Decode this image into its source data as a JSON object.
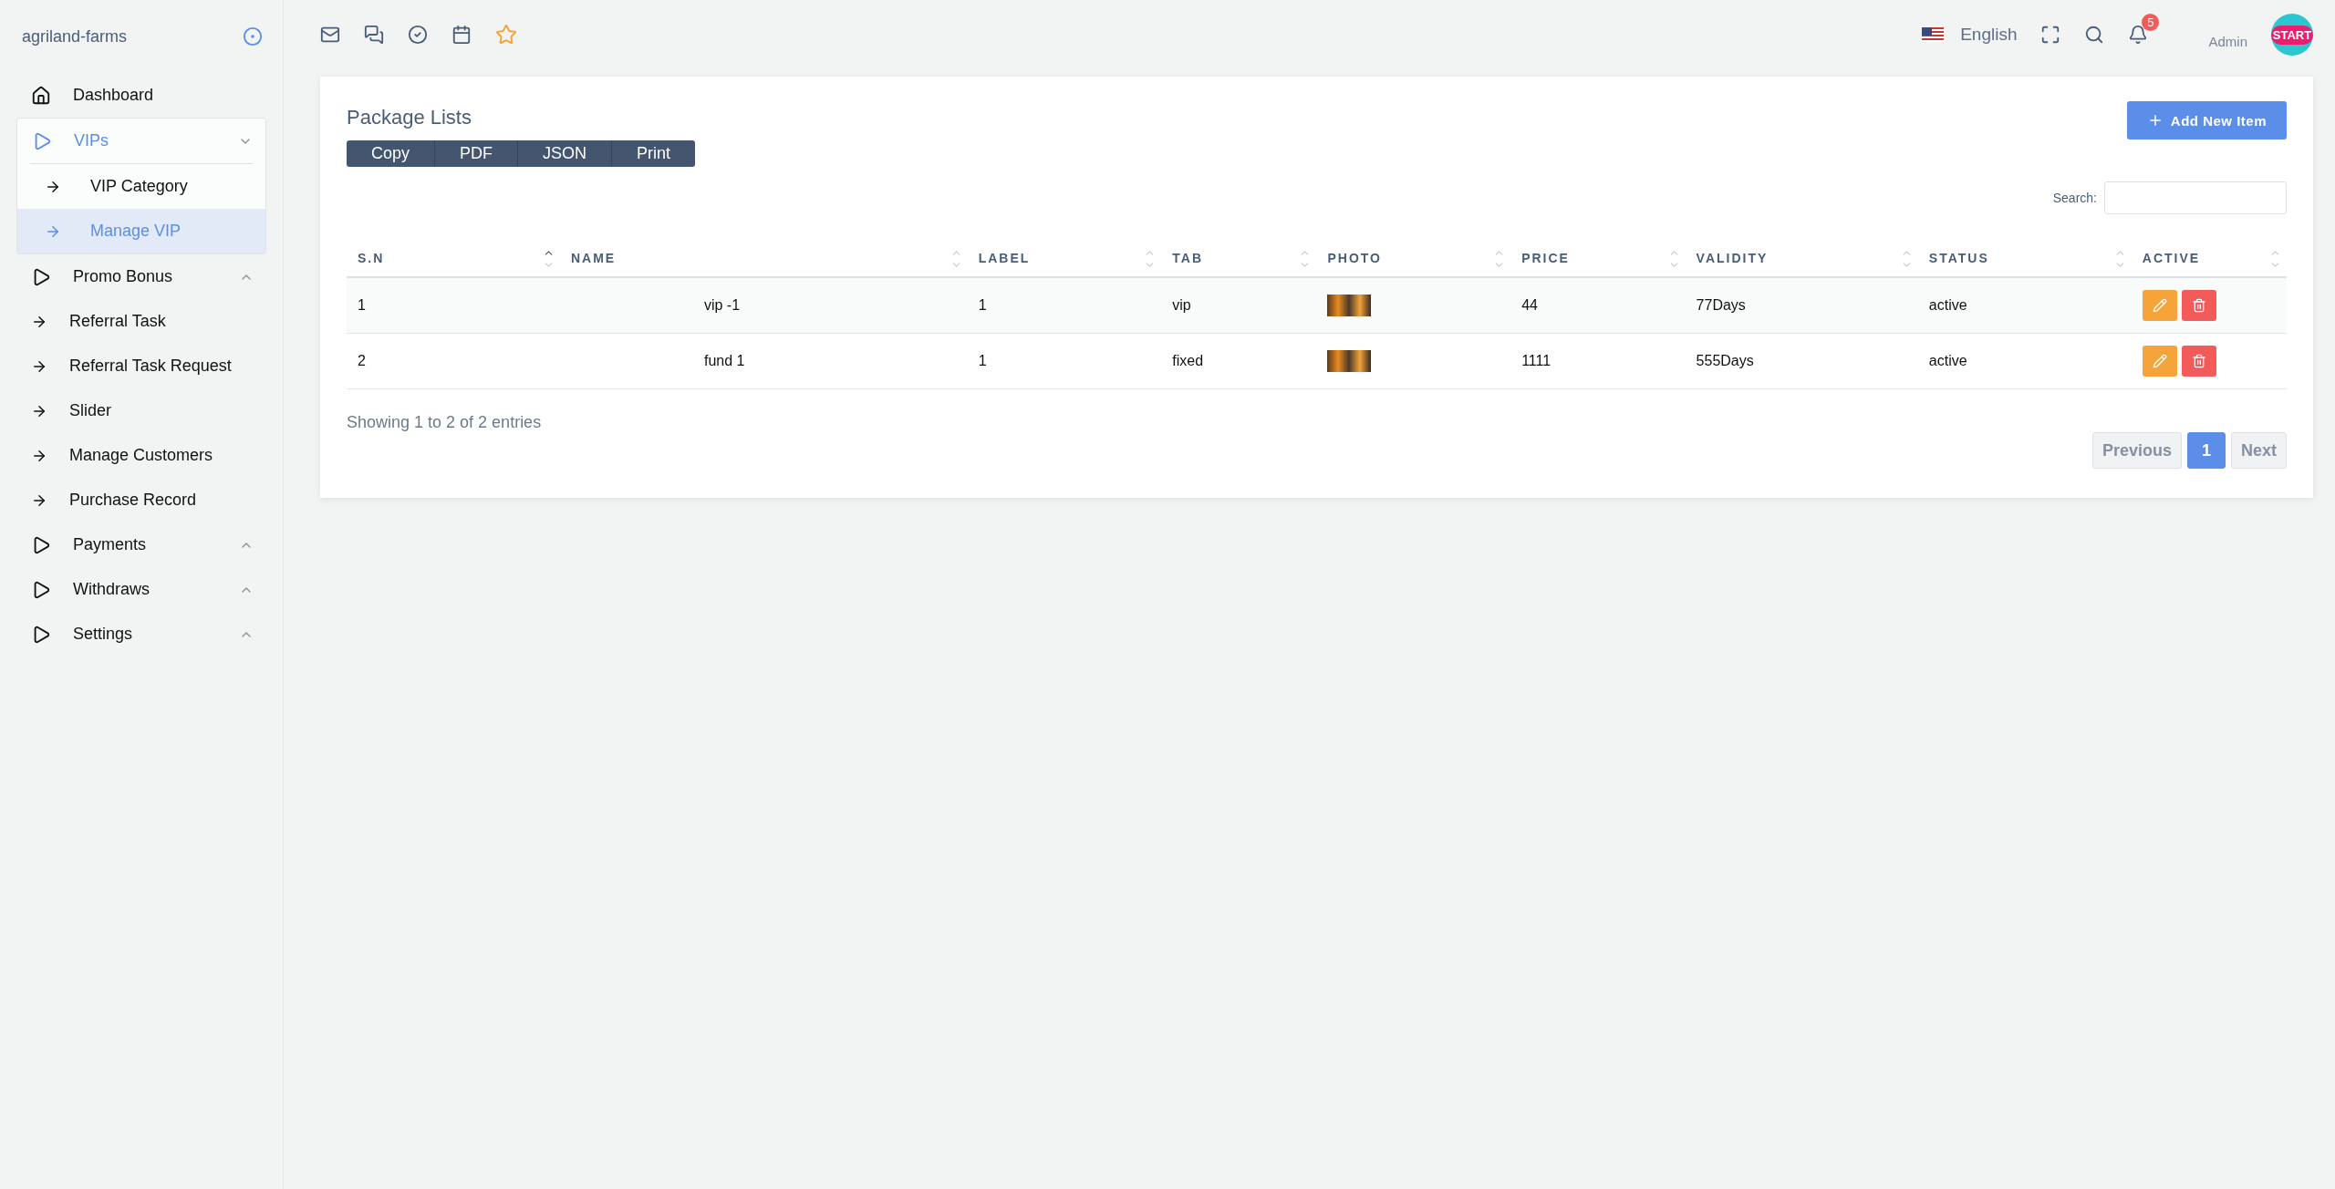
{
  "sidebar": {
    "brand": "agriland-farms",
    "items": [
      {
        "kind": "home",
        "label": "Dashboard",
        "selected": false
      },
      {
        "kind": "group",
        "label": "VIPs",
        "expanded": true,
        "children": [
          {
            "label": "VIP Category",
            "selected": false
          },
          {
            "label": "Manage VIP",
            "selected": true
          }
        ]
      },
      {
        "kind": "group",
        "label": "Promo Bonus",
        "expanded": false
      },
      {
        "kind": "link",
        "label": "Referral Task",
        "selected": false
      },
      {
        "kind": "link",
        "label": "Referral Task Request",
        "selected": false
      },
      {
        "kind": "link",
        "label": "Slider",
        "selected": false
      },
      {
        "kind": "link",
        "label": "Manage Customers",
        "selected": false
      },
      {
        "kind": "link",
        "label": "Purchase Record",
        "selected": false
      },
      {
        "kind": "group",
        "label": "Payments",
        "expanded": false
      },
      {
        "kind": "group",
        "label": "Withdraws",
        "expanded": false
      },
      {
        "kind": "group",
        "label": "Settings",
        "expanded": false
      }
    ]
  },
  "topbar": {
    "language": "English",
    "notifications": "5",
    "user": "Admin",
    "avatar": "START"
  },
  "card": {
    "title": "Package Lists",
    "export_buttons": [
      "Copy",
      "PDF",
      "JSON",
      "Print"
    ],
    "add_button": "Add New Item",
    "search_label": "Search:",
    "columns": [
      {
        "label": "S.N",
        "sorted": true
      },
      {
        "label": "NAME",
        "sorted": false
      },
      {
        "label": "LABEL",
        "sorted": false
      },
      {
        "label": "TAB",
        "sorted": false
      },
      {
        "label": "PHOTO",
        "sorted": false
      },
      {
        "label": "PRICE",
        "sorted": false
      },
      {
        "label": "VALIDITY",
        "sorted": false
      },
      {
        "label": "STATUS",
        "sorted": false
      },
      {
        "label": "ACTIVE",
        "sorted": false
      }
    ],
    "rows": [
      {
        "sn": "1",
        "name": "vip -1",
        "label": "1",
        "tab": "vip",
        "price": "44",
        "validity": "77Days",
        "status": "active"
      },
      {
        "sn": "2",
        "name": "fund 1",
        "label": "1",
        "tab": "fixed",
        "price": "1111",
        "validity": "555Days",
        "status": "active"
      }
    ],
    "info": "Showing 1 to 2 of 2 entries",
    "pagination": [
      {
        "label": "Previous",
        "selected": false
      },
      {
        "label": "1",
        "selected": true
      },
      {
        "label": "Next",
        "selected": false
      }
    ]
  }
}
